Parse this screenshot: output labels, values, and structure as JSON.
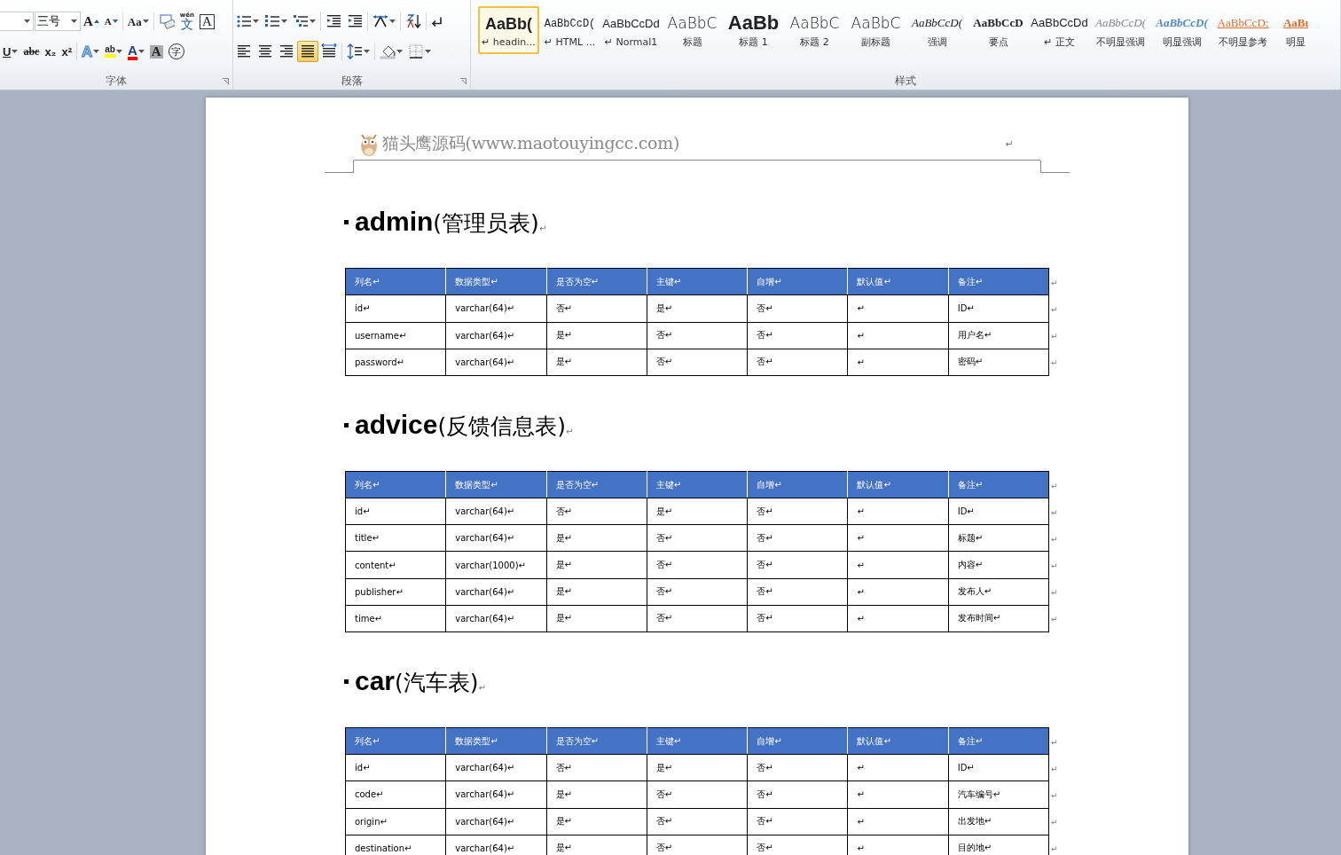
{
  "ribbon": {
    "font_group": {
      "label": "字体",
      "font_size": {
        "value": "三号"
      },
      "row1": [
        {
          "kind": "grow",
          "glyph": "A",
          "dropdown": false
        },
        {
          "kind": "shrink",
          "glyph": "A",
          "dropdown": false
        },
        {
          "kind": "case",
          "glyph": "Aa",
          "dropdown": true
        },
        {
          "kind": "clear",
          "dropdown": false
        },
        {
          "kind": "phonetic",
          "glyph": "文",
          "ruby": "wén",
          "dropdown": false
        },
        {
          "kind": "boxed",
          "glyph": "A",
          "dropdown": false
        }
      ],
      "row2": [
        {
          "kind": "underline",
          "glyph": "U",
          "dropdown": true
        },
        {
          "kind": "strike",
          "glyph": "abc",
          "dropdown": false
        },
        {
          "kind": "sub",
          "glyph": "x₂",
          "dropdown": false
        },
        {
          "kind": "sup",
          "glyph": "x²",
          "dropdown": false
        },
        {
          "kind": "effects",
          "glyph": "A",
          "dropdown": true
        },
        {
          "kind": "highlight",
          "glyph": "ab",
          "dropdown": true
        },
        {
          "kind": "color",
          "glyph": "A",
          "dropdown": true
        },
        {
          "kind": "shade",
          "glyph": "A",
          "dropdown": false
        },
        {
          "kind": "enclose",
          "glyph": "字",
          "dropdown": false
        }
      ]
    },
    "paragraph_group": {
      "label": "段落",
      "row1": [
        {
          "kind": "bullets",
          "dropdown": true,
          "selected": false
        },
        {
          "kind": "numbering",
          "dropdown": true,
          "selected": false
        },
        {
          "kind": "multilevel",
          "dropdown": true,
          "selected": false
        },
        {
          "kind": "outdent",
          "dropdown": false,
          "selected": false
        },
        {
          "kind": "indent",
          "dropdown": false,
          "selected": false
        },
        {
          "kind": "asian",
          "dropdown": true,
          "selected": false
        },
        {
          "kind": "sort",
          "dropdown": false,
          "selected": false
        },
        {
          "kind": "marks",
          "dropdown": false,
          "selected": false
        }
      ],
      "row2": [
        {
          "kind": "left",
          "dropdown": false,
          "selected": false
        },
        {
          "kind": "center",
          "dropdown": false,
          "selected": false
        },
        {
          "kind": "right",
          "dropdown": false,
          "selected": false
        },
        {
          "kind": "justify",
          "dropdown": false,
          "selected": true
        },
        {
          "kind": "distributed",
          "dropdown": false,
          "selected": false
        },
        {
          "kind": "spacing",
          "dropdown": true,
          "selected": false
        },
        {
          "kind": "fill",
          "dropdown": true,
          "selected": false
        },
        {
          "kind": "borders",
          "dropdown": true,
          "selected": false
        }
      ]
    },
    "styles_group": {
      "label": "样式",
      "styles": [
        {
          "kind": "heading",
          "preview": "AaBb(",
          "name": "↵ headin...",
          "selected": true
        },
        {
          "kind": "mono",
          "preview": "AaBbCcD(",
          "name": "↵ HTML ...",
          "selected": false
        },
        {
          "kind": "normal",
          "preview": "AaBbCcDd",
          "name": "↵ Normal1",
          "selected": false
        },
        {
          "kind": "title",
          "preview": "AaBbC",
          "name": "标题",
          "selected": false
        },
        {
          "kind": "h1",
          "preview": "AaBb",
          "name": "标题 1",
          "selected": false
        },
        {
          "kind": "title",
          "preview": "AaBbC",
          "name": "标题 2",
          "selected": false
        },
        {
          "kind": "title",
          "preview": "AaBbC",
          "name": "副标题",
          "selected": false
        },
        {
          "kind": "emphasis",
          "preview": "AaBbCcD(",
          "name": "强调",
          "selected": false
        },
        {
          "kind": "strong",
          "preview": "AaBbCcD",
          "name": "要点",
          "selected": false
        },
        {
          "kind": "normal",
          "preview": "AaBbCcDd",
          "name": "↵ 正文",
          "selected": false
        },
        {
          "kind": "subtle",
          "preview": "AaBbCcD(",
          "name": "不明显强调",
          "selected": false
        },
        {
          "kind": "intense",
          "preview": "AaBbCcD(",
          "name": "明显强调",
          "selected": false
        },
        {
          "kind": "ref",
          "preview": "AaBbCcD:",
          "name": "不明显参考",
          "selected": false
        },
        {
          "kind": "intref",
          "preview": "AaBı",
          "name": "明显",
          "selected": false
        }
      ]
    }
  },
  "document": {
    "header": {
      "text": "猫头鹰源码(www.maotouyingcc.com)",
      "mark": "↵"
    },
    "sections": [
      {
        "title": "**admin**(管理员表)",
        "mark": "↵",
        "table": {
          "columns": [
            "列名↵",
            "数据类型↵",
            "是否为空↵",
            "主键↵",
            "自增↵",
            "默认值↵",
            "备注↵"
          ],
          "header_end": "↵",
          "rows": [
            {
              "cells": [
                "id↵",
                "varchar(64)↵",
                "否↵",
                "是↵",
                "否↵",
                "↵",
                "ID↵"
              ],
              "end": "↵"
            },
            {
              "cells": [
                "username↵",
                "varchar(64)↵",
                "是↵",
                "否↵",
                "否↵",
                "↵",
                "用户名↵"
              ],
              "end": "↵"
            },
            {
              "cells": [
                "password↵",
                "varchar(64)↵",
                "是↵",
                "否↵",
                "否↵",
                "↵",
                "密码↵"
              ],
              "end": "↵"
            }
          ]
        }
      },
      {
        "title": "**advice**(反馈信息表)",
        "mark": "↵",
        "table": {
          "columns": [
            "列名↵",
            "数据类型↵",
            "是否为空↵",
            "主键↵",
            "自增↵",
            "默认值↵",
            "备注↵"
          ],
          "header_end": "↵",
          "rows": [
            {
              "cells": [
                "id↵",
                "varchar(64)↵",
                "否↵",
                "是↵",
                "否↵",
                "↵",
                "ID↵"
              ],
              "end": "↵"
            },
            {
              "cells": [
                "title↵",
                "varchar(64)↵",
                "是↵",
                "否↵",
                "否↵",
                "↵",
                "标题↵"
              ],
              "end": "↵"
            },
            {
              "cells": [
                "content↵",
                "varchar(1000)↵",
                "是↵",
                "否↵",
                "否↵",
                "↵",
                "内容↵"
              ],
              "end": "↵"
            },
            {
              "cells": [
                "publisher↵",
                "varchar(64)↵",
                "是↵",
                "否↵",
                "否↵",
                "↵",
                "发布人↵"
              ],
              "end": "↵"
            },
            {
              "cells": [
                "time↵",
                "varchar(64)↵",
                "是↵",
                "否↵",
                "否↵",
                "↵",
                "发布时间↵"
              ],
              "end": "↵"
            }
          ]
        }
      },
      {
        "title": "**car**(汽车表)",
        "mark": "↵",
        "table": {
          "columns": [
            "列名↵",
            "数据类型↵",
            "是否为空↵",
            "主键↵",
            "自增↵",
            "默认值↵",
            "备注↵"
          ],
          "header_end": "↵",
          "rows": [
            {
              "cells": [
                "id↵",
                "varchar(64)↵",
                "否↵",
                "是↵",
                "否↵",
                "↵",
                "ID↵"
              ],
              "end": "↵"
            },
            {
              "cells": [
                "code↵",
                "varchar(64)↵",
                "是↵",
                "否↵",
                "否↵",
                "↵",
                "汽车编号↵"
              ],
              "end": "↵"
            },
            {
              "cells": [
                "origin↵",
                "varchar(64)↵",
                "是↵",
                "否↵",
                "否↵",
                "↵",
                "出发地↵"
              ],
              "end": "↵"
            },
            {
              "cells": [
                "destination↵",
                "varchar(64)↵",
                "是↵",
                "否↵",
                "否↵",
                "↵",
                "目的地↵"
              ],
              "end": "↵"
            }
          ]
        }
      }
    ]
  }
}
